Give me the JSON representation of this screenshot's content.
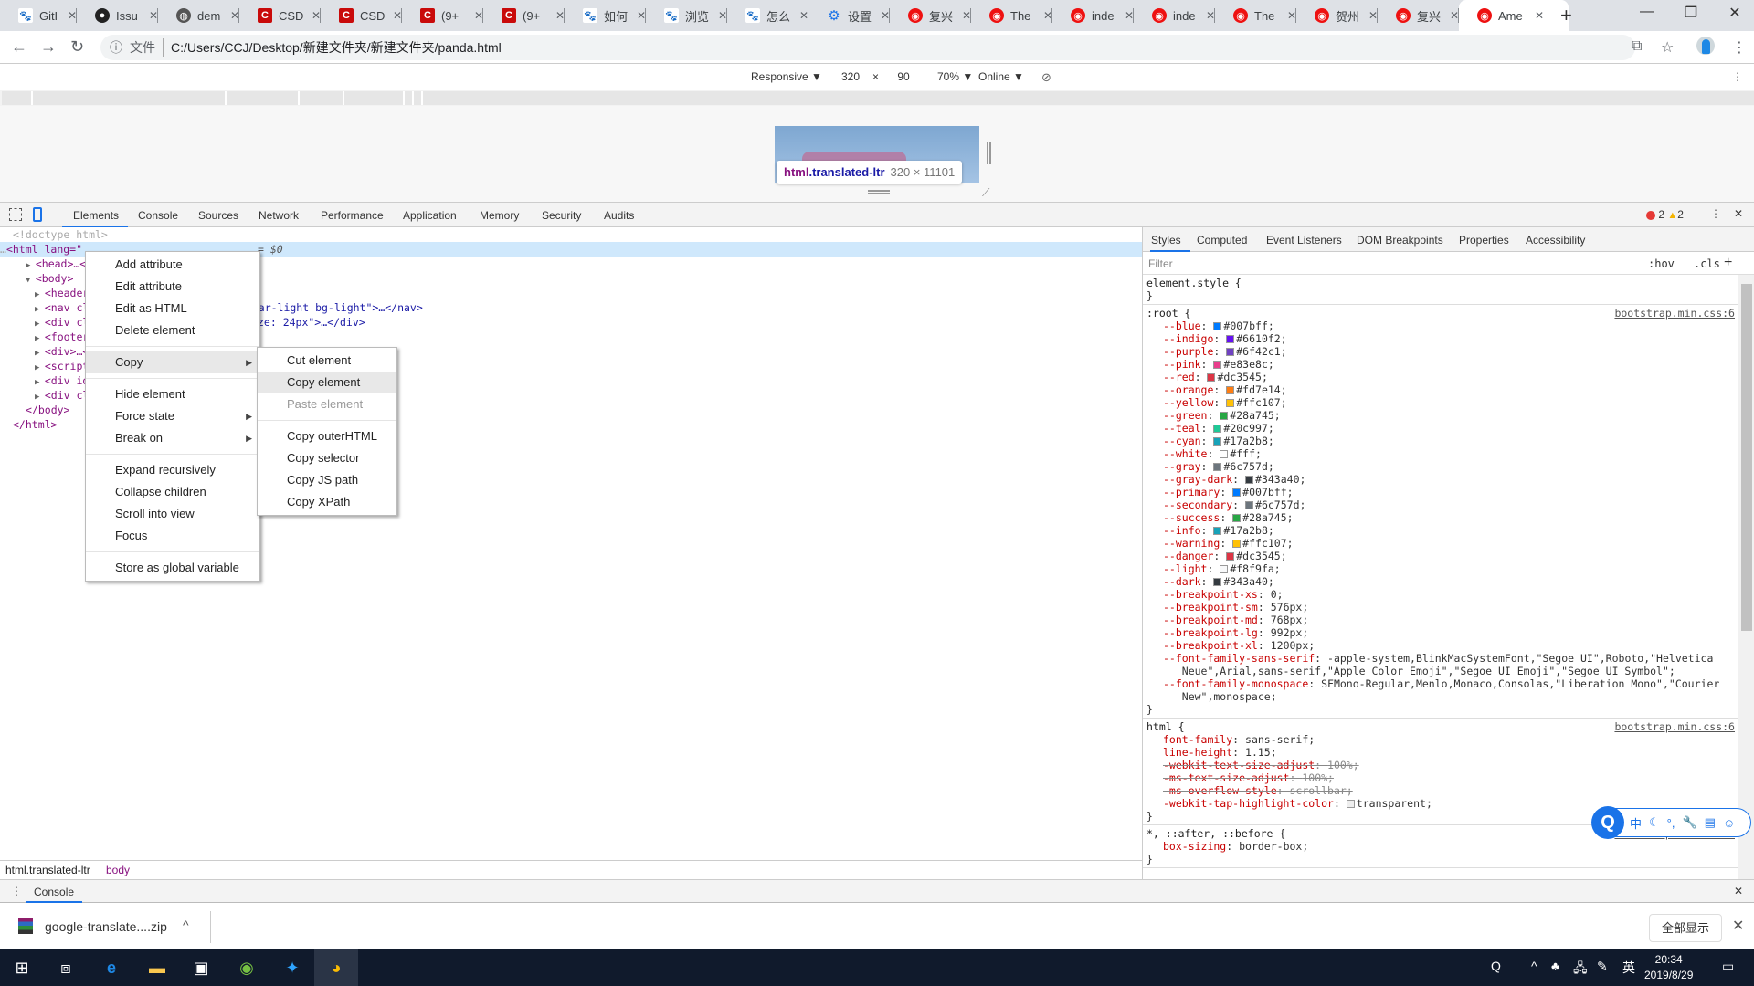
{
  "browser": {
    "tabs": [
      {
        "favicon": "baidu-paw",
        "title": "GitH"
      },
      {
        "favicon": "github",
        "title": "Issu"
      },
      {
        "favicon": "globe",
        "title": "dem"
      },
      {
        "favicon": "csdn",
        "title": "CSD"
      },
      {
        "favicon": "csdn",
        "title": "CSD"
      },
      {
        "favicon": "csdn",
        "title": "(9+"
      },
      {
        "favicon": "csdn",
        "title": "(9+"
      },
      {
        "favicon": "baidu-paw",
        "title": "如何"
      },
      {
        "favicon": "baidu-paw",
        "title": "浏览"
      },
      {
        "favicon": "baidu-paw",
        "title": "怎么"
      },
      {
        "favicon": "gear",
        "title": "设置"
      },
      {
        "favicon": "red-circle",
        "title": "复兴"
      },
      {
        "favicon": "red-circle",
        "title": "The"
      },
      {
        "favicon": "red-circle",
        "title": "inde"
      },
      {
        "favicon": "red-circle",
        "title": "inde"
      },
      {
        "favicon": "red-circle",
        "title": "The"
      },
      {
        "favicon": "red-circle",
        "title": "贺州"
      },
      {
        "favicon": "red-circle",
        "title": "复兴"
      },
      {
        "favicon": "red-circle",
        "title": "Ame",
        "active": true
      }
    ],
    "close_glyph": "✕",
    "new_tab": "+",
    "window_controls": {
      "minimize": "—",
      "maximize": "❐",
      "close": "✕"
    },
    "address": {
      "scheme_label": "文件",
      "url": "C:/Users/CCJ/Desktop/新建文件夹/新建文件夹/panda.html"
    }
  },
  "device_toolbar": {
    "preset": "Responsive ▼",
    "width": "320",
    "times": "×",
    "height": "90",
    "zoom": "70% ▼",
    "throttle": "Online ▼"
  },
  "preview_tooltip": {
    "tag": "html",
    "cls": ".translated-ltr",
    "dims": "320 × 11101"
  },
  "devtools": {
    "tabs": [
      "Elements",
      "Console",
      "Sources",
      "Network",
      "Performance",
      "Application",
      "Memory",
      "Security",
      "Audits"
    ],
    "active_tab": "Elements",
    "errors": "2",
    "warnings": "2",
    "dom_lines": [
      {
        "text": "<!doctype html>"
      },
      {
        "text": "<html lang=\"",
        "suffix": "= $0"
      },
      {
        "text": "<head>…</he"
      },
      {
        "text": "<body>"
      },
      {
        "text": "<header>…"
      },
      {
        "text": "<nav clas",
        "tail": "avbar-light bg-light\">…</nav>"
      },
      {
        "text": "<div clas",
        "tail": "ze: 24px\">…</div>"
      },
      {
        "text": "<footer c"
      },
      {
        "text": "<div>…</d"
      },
      {
        "text": "<script t"
      },
      {
        "text": "<div id=\""
      },
      {
        "text": "<div clas"
      },
      {
        "text": "</body>"
      },
      {
        "text": "</html>"
      }
    ],
    "breadcrumbs": [
      "html.translated-ltr",
      "body"
    ],
    "side_tabs": [
      "Styles",
      "Computed",
      "Event Listeners",
      "DOM Breakpoints",
      "Properties",
      "Accessibility"
    ],
    "filter_placeholder": "Filter",
    "hov": ":hov",
    "cls": ".cls",
    "add": "+",
    "rules": [
      {
        "selector": "element.style {",
        "source": "",
        "decls": []
      },
      {
        "selector": ":root {",
        "source": "bootstrap.min.css:6",
        "decls": [
          {
            "name": "--blue",
            "value": "#007bff;",
            "swatch": "#007bff"
          },
          {
            "name": "--indigo",
            "value": "#6610f2;",
            "swatch": "#6610f2"
          },
          {
            "name": "--purple",
            "value": "#6f42c1;",
            "swatch": "#6f42c1"
          },
          {
            "name": "--pink",
            "value": "#e83e8c;",
            "swatch": "#e83e8c"
          },
          {
            "name": "--red",
            "value": "#dc3545;",
            "swatch": "#dc3545"
          },
          {
            "name": "--orange",
            "value": "#fd7e14;",
            "swatch": "#fd7e14"
          },
          {
            "name": "--yellow",
            "value": "#ffc107;",
            "swatch": "#ffc107"
          },
          {
            "name": "--green",
            "value": "#28a745;",
            "swatch": "#28a745"
          },
          {
            "name": "--teal",
            "value": "#20c997;",
            "swatch": "#20c997"
          },
          {
            "name": "--cyan",
            "value": "#17a2b8;",
            "swatch": "#17a2b8"
          },
          {
            "name": "--white",
            "value": "#fff;",
            "swatch": "#ffffff"
          },
          {
            "name": "--gray",
            "value": "#6c757d;",
            "swatch": "#6c757d"
          },
          {
            "name": "--gray-dark",
            "value": "#343a40;",
            "swatch": "#343a40"
          },
          {
            "name": "--primary",
            "value": "#007bff;",
            "swatch": "#007bff"
          },
          {
            "name": "--secondary",
            "value": "#6c757d;",
            "swatch": "#6c757d"
          },
          {
            "name": "--success",
            "value": "#28a745;",
            "swatch": "#28a745"
          },
          {
            "name": "--info",
            "value": "#17a2b8;",
            "swatch": "#17a2b8"
          },
          {
            "name": "--warning",
            "value": "#ffc107;",
            "swatch": "#ffc107"
          },
          {
            "name": "--danger",
            "value": "#dc3545;",
            "swatch": "#dc3545"
          },
          {
            "name": "--light",
            "value": "#f8f9fa;",
            "swatch": "#f8f9fa"
          },
          {
            "name": "--dark",
            "value": "#343a40;",
            "swatch": "#343a40"
          },
          {
            "name": "--breakpoint-xs",
            "value": "0;"
          },
          {
            "name": "--breakpoint-sm",
            "value": "576px;"
          },
          {
            "name": "--breakpoint-md",
            "value": "768px;"
          },
          {
            "name": "--breakpoint-lg",
            "value": "992px;"
          },
          {
            "name": "--breakpoint-xl",
            "value": "1200px;"
          },
          {
            "name": "--font-family-sans-serif",
            "value": "-apple-system,BlinkMacSystemFont,\"Segoe UI\",Roboto,\"Helvetica\n   Neue\",Arial,sans-serif,\"Apple Color Emoji\",\"Segoe UI Emoji\",\"Segoe UI Symbol\";"
          },
          {
            "name": "--font-family-monospace",
            "value": "SFMono-Regular,Menlo,Monaco,Consolas,\"Liberation Mono\",\"Courier\n   New\",monospace;"
          }
        ]
      },
      {
        "selector": "html {",
        "source": "bootstrap.min.css:6",
        "decls": [
          {
            "name": "font-family",
            "value": "sans-serif;"
          },
          {
            "name": "line-height",
            "value": "1.15;"
          },
          {
            "name": "-webkit-text-size-adjust",
            "value": "100%;",
            "struck": true
          },
          {
            "name": "-ms-text-size-adjust",
            "value": "100%;",
            "struck": true
          },
          {
            "name": "-ms-overflow-style",
            "value": "scrollbar;",
            "struck": true
          },
          {
            "name": "-webkit-tap-highlight-color",
            "value": "transparent;",
            "swatch": "transparent"
          }
        ]
      },
      {
        "selector": "*, ::after, ::before {",
        "source": "bootstrap.min.css:6",
        "decls": [
          {
            "name": "box-sizing",
            "value": "border-box;"
          }
        ]
      }
    ],
    "drawer_tab": "Console"
  },
  "context_menu": {
    "items": [
      "Add attribute",
      "Edit attribute",
      "Edit as HTML",
      "Delete element",
      "Copy",
      "Hide element",
      "Force state",
      "Break on",
      "Expand recursively",
      "Collapse children",
      "Scroll into view",
      "Focus",
      "Store as global variable"
    ],
    "submenu": [
      "Cut element",
      "Copy element",
      "Paste element",
      "Copy outerHTML",
      "Copy selector",
      "Copy JS path",
      "Copy XPath"
    ]
  },
  "ime": {
    "mode": "中",
    "items": [
      "☾",
      "°,",
      "🔧",
      "▤",
      "☺"
    ]
  },
  "download_bar": {
    "file": "google-translate....zip",
    "show_all": "全部显示"
  },
  "taskbar": {
    "time": "20:34",
    "date": "2019/8/29",
    "lang": "英"
  }
}
